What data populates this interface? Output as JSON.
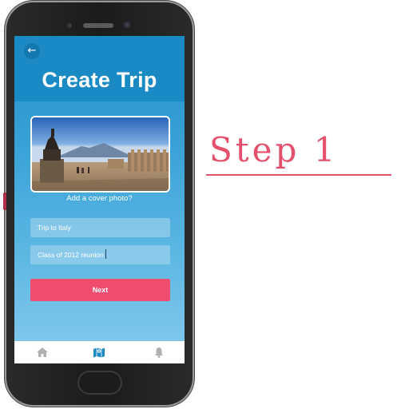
{
  "header": {
    "back_icon": "←",
    "title": "Create Trip"
  },
  "cover": {
    "caption": "Add a cover photo?"
  },
  "form": {
    "trip_name": "Trip to Italy",
    "description": "Class of 2012 reunion"
  },
  "actions": {
    "next_label": "Next"
  },
  "tabbar": {
    "items": [
      "home-icon",
      "map-icon",
      "bell-icon"
    ],
    "active": "map-icon"
  },
  "annotation": {
    "step_label": "Step 1"
  },
  "colors": {
    "primary": "#1a8ac4",
    "accent": "#f04d6e",
    "step": "#e4506c",
    "tab_inactive": "#b0b0b0",
    "tab_active": "#1a8ac4"
  }
}
